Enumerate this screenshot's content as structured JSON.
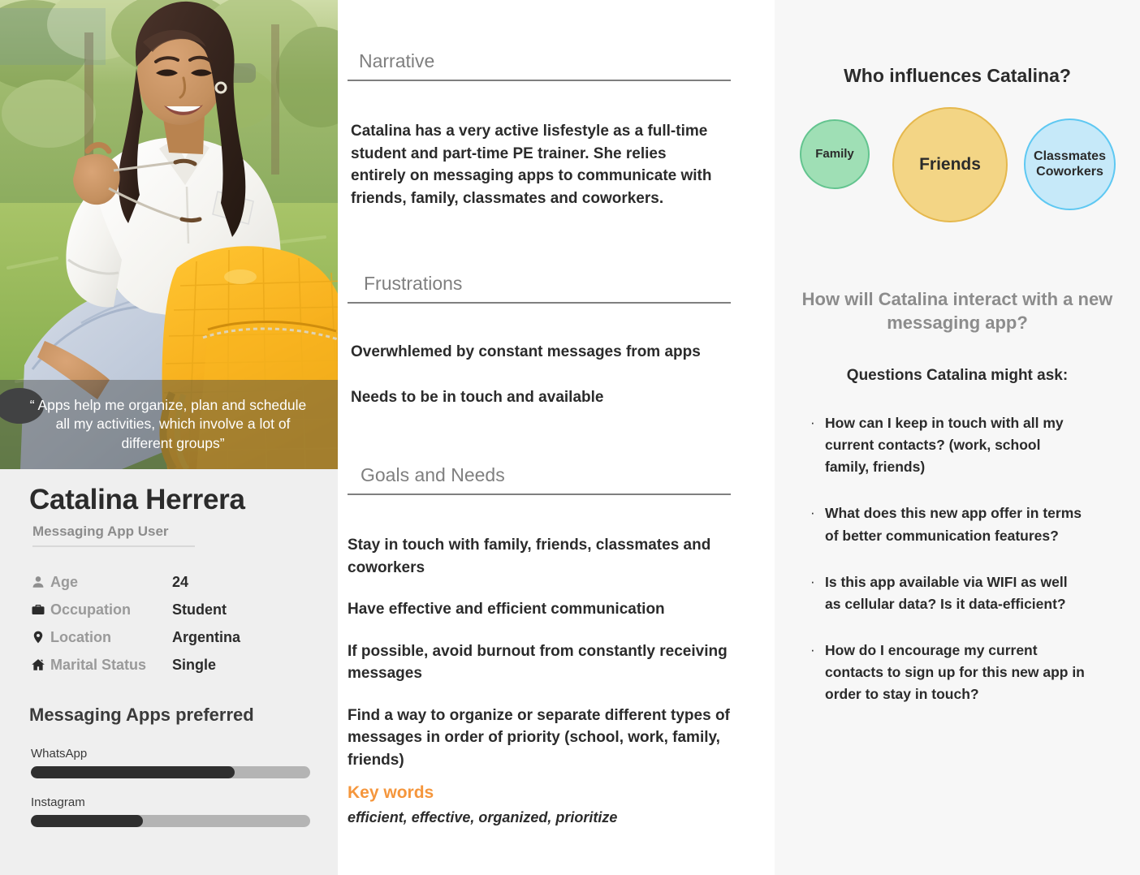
{
  "persona": {
    "quote": "“ Apps help me organize, plan and schedule all my activities, which involve a lot of different groups”",
    "name": "Catalina Herrera",
    "role": "Messaging App User",
    "demographics": [
      {
        "icon": "person-icon",
        "label": "Age",
        "value": "24"
      },
      {
        "icon": "briefcase-icon",
        "label": "Occupation",
        "value": "Student"
      },
      {
        "icon": "map-pin-icon",
        "label": "Location",
        "value": "Argentina"
      },
      {
        "icon": "house-icon",
        "label": "Marital Status",
        "value": "Single"
      }
    ],
    "apps_title": "Messaging Apps preferred",
    "apps": [
      {
        "name": "WhatsApp",
        "percent": 73
      },
      {
        "name": "Instagram",
        "percent": 40
      }
    ]
  },
  "narrative": {
    "heading": "Narrative",
    "text": "Catalina has a very active lisfestyle as a full-time student and part-time PE trainer. She relies entirely on messaging apps to communicate with friends, family, classmates and coworkers."
  },
  "frustrations": {
    "heading": "Frustrations",
    "items": [
      "Overwhlemed by constant messages from apps",
      "Needs to be in touch and available"
    ]
  },
  "goals": {
    "heading": "Goals and Needs",
    "items": [
      "Stay in touch with family, friends, classmates and coworkers",
      "Have effective and efficient communication",
      "If possible, avoid burnout from constantly receiving messages",
      "Find a way to organize or separate different types of messages in order of priority (school, work, family, friends)"
    ]
  },
  "keywords": {
    "title": "Key words",
    "words": "efficient, effective, organized, prioritize",
    "color": "#f5963c"
  },
  "influences": {
    "title": "Who influences Catalina?",
    "circles": [
      {
        "label": "Family",
        "fill": "#9fdfb5",
        "stroke": "#63c48f",
        "diameter": 86
      },
      {
        "label": "Friends",
        "fill": "#f3d585",
        "stroke": "#e5b84d",
        "diameter": 142
      },
      {
        "label": "Classmates\nCoworkers",
        "fill": "#c6e9f9",
        "stroke": "#5ec8f2",
        "diameter": 113
      }
    ]
  },
  "interaction": {
    "heading": "How will Catalina interact with a new messaging app?",
    "questions_title": "Questions Catalina might ask:",
    "bullet": "·",
    "questions": [
      "How can I keep in touch with all my current contacts? (work, school family, friends)",
      "What does this new app offer in terms of better communication features?",
      "Is this app available via WIFI as well as cellular data? Is it data-efficient?",
      "How do I encourage my current contacts to sign up for this new app in order to stay in touch?"
    ]
  }
}
